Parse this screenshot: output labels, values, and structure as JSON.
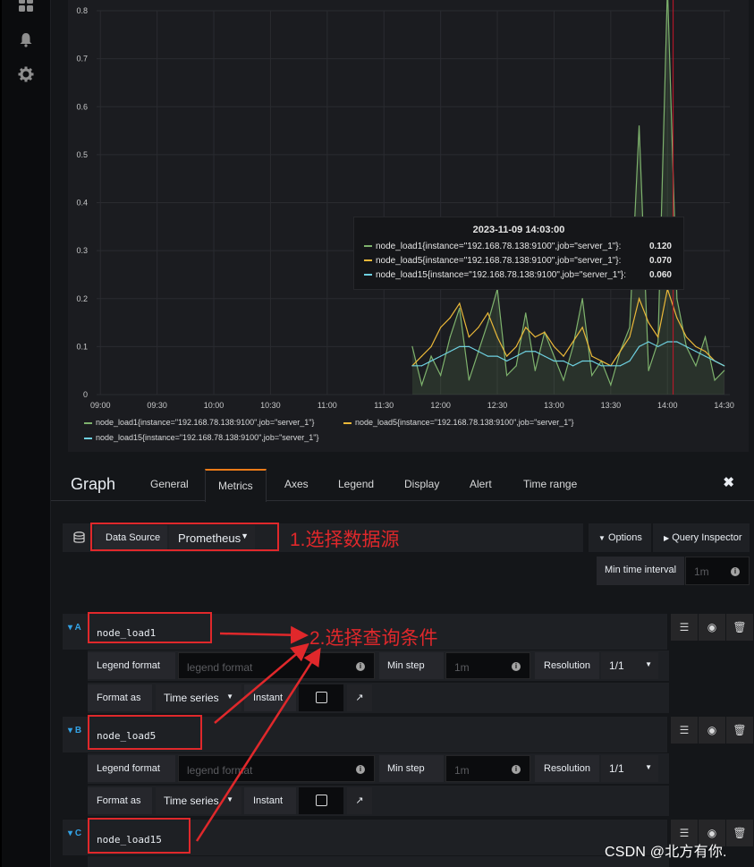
{
  "sidebar": {
    "icons": [
      "dashboard-icon",
      "bell-icon",
      "gear-icon"
    ]
  },
  "chart_data": {
    "type": "line",
    "title": "",
    "xlabel": "",
    "ylabel": "",
    "ylim": [
      0,
      0.8
    ],
    "y_ticks": [
      "0",
      "0.1",
      "0.2",
      "0.3",
      "0.4",
      "0.5",
      "0.6",
      "0.7",
      "0.8"
    ],
    "x_ticks": [
      "09:00",
      "09:30",
      "10:00",
      "10:30",
      "11:00",
      "11:30",
      "12:00",
      "12:30",
      "13:00",
      "13:30",
      "14:00",
      "14:30"
    ],
    "grid": true,
    "legend_position": "bottom-left",
    "series": [
      {
        "name": "node_load1{instance=\"192.168.78.138:9100\",job=\"server_1\"}",
        "color": "#7eb26d",
        "x": [
          "11:45",
          "11:50",
          "11:55",
          "12:00",
          "12:05",
          "12:10",
          "12:15",
          "12:20",
          "12:25",
          "12:30",
          "12:35",
          "12:40",
          "12:45",
          "12:50",
          "12:55",
          "13:00",
          "13:05",
          "13:10",
          "13:15",
          "13:20",
          "13:25",
          "13:30",
          "13:35",
          "13:40",
          "13:45",
          "13:50",
          "13:55",
          "14:00",
          "14:05",
          "14:10",
          "14:15",
          "14:20",
          "14:25",
          "14:30"
        ],
        "values": [
          0.1,
          0.02,
          0.08,
          0.04,
          0.12,
          0.18,
          0.03,
          0.09,
          0.15,
          0.22,
          0.04,
          0.06,
          0.17,
          0.05,
          0.13,
          0.08,
          0.03,
          0.1,
          0.2,
          0.04,
          0.07,
          0.02,
          0.09,
          0.14,
          0.56,
          0.05,
          0.11,
          0.85,
          0.2,
          0.1,
          0.06,
          0.12,
          0.03,
          0.05
        ]
      },
      {
        "name": "node_load5{instance=\"192.168.78.138:9100\",job=\"server_1\"}",
        "color": "#eab839",
        "x": [
          "11:45",
          "11:50",
          "11:55",
          "12:00",
          "12:05",
          "12:10",
          "12:15",
          "12:20",
          "12:25",
          "12:30",
          "12:35",
          "12:40",
          "12:45",
          "12:50",
          "12:55",
          "13:00",
          "13:05",
          "13:10",
          "13:15",
          "13:20",
          "13:25",
          "13:30",
          "13:35",
          "13:40",
          "13:45",
          "13:50",
          "13:55",
          "14:00",
          "14:05",
          "14:10",
          "14:15",
          "14:20",
          "14:25",
          "14:30"
        ],
        "values": [
          0.06,
          0.08,
          0.1,
          0.14,
          0.16,
          0.19,
          0.12,
          0.14,
          0.17,
          0.12,
          0.08,
          0.1,
          0.14,
          0.12,
          0.13,
          0.1,
          0.08,
          0.11,
          0.14,
          0.08,
          0.07,
          0.06,
          0.09,
          0.12,
          0.2,
          0.15,
          0.12,
          0.22,
          0.16,
          0.12,
          0.1,
          0.09,
          0.07,
          0.06
        ]
      },
      {
        "name": "node_load15{instance=\"192.168.78.138:9100\",job=\"server_1\"}",
        "color": "#6ed0e0",
        "x": [
          "11:45",
          "11:50",
          "11:55",
          "12:00",
          "12:05",
          "12:10",
          "12:15",
          "12:20",
          "12:25",
          "12:30",
          "12:35",
          "12:40",
          "12:45",
          "12:50",
          "12:55",
          "13:00",
          "13:05",
          "13:10",
          "13:15",
          "13:20",
          "13:25",
          "13:30",
          "13:35",
          "13:40",
          "13:45",
          "13:50",
          "13:55",
          "14:00",
          "14:05",
          "14:10",
          "14:15",
          "14:20",
          "14:25",
          "14:30"
        ],
        "values": [
          0.06,
          0.06,
          0.07,
          0.08,
          0.09,
          0.1,
          0.1,
          0.09,
          0.08,
          0.08,
          0.07,
          0.08,
          0.09,
          0.09,
          0.08,
          0.07,
          0.07,
          0.06,
          0.07,
          0.07,
          0.06,
          0.06,
          0.06,
          0.07,
          0.1,
          0.11,
          0.1,
          0.11,
          0.11,
          0.1,
          0.09,
          0.08,
          0.07,
          0.06
        ]
      }
    ]
  },
  "tooltip": {
    "title": "2023-11-09 14:03:00",
    "rows": [
      {
        "name": "node_load1{instance=\"192.168.78.138:9100\",job=\"server_1\"}:",
        "value": "0.120",
        "color": "#7eb26d"
      },
      {
        "name": "node_load5{instance=\"192.168.78.138:9100\",job=\"server_1\"}:",
        "value": "0.070",
        "color": "#eab839"
      },
      {
        "name": "node_load15{instance=\"192.168.78.138:9100\",job=\"server_1\"}:",
        "value": "0.060",
        "color": "#6ed0e0"
      }
    ]
  },
  "editor": {
    "title": "Graph",
    "tabs": [
      "General",
      "Metrics",
      "Axes",
      "Legend",
      "Display",
      "Alert",
      "Time range"
    ],
    "active_tab": "Metrics",
    "close": "✖"
  },
  "datasource": {
    "label": "Data Source",
    "value": "Prometheus",
    "options_btn": "Options",
    "inspector_btn": "Query Inspector",
    "min_interval_label": "Min time interval",
    "min_interval_placeholder": "1m"
  },
  "annotations": {
    "a1": "1.选择数据源",
    "a2": "2.选择查询条件"
  },
  "queries": [
    {
      "letter": "A",
      "expr": "node_load1"
    },
    {
      "letter": "B",
      "expr": "node_load5"
    },
    {
      "letter": "C",
      "expr": "node_load15"
    }
  ],
  "query_options": {
    "legend_label": "Legend format",
    "legend_placeholder": "legend format",
    "minstep_label": "Min step",
    "minstep_placeholder": "1m",
    "resolution_label": "Resolution",
    "resolution_value": "1/1",
    "format_label": "Format as",
    "format_value": "Time series",
    "instant_label": "Instant"
  },
  "watermark": "CSDN @北方有你."
}
